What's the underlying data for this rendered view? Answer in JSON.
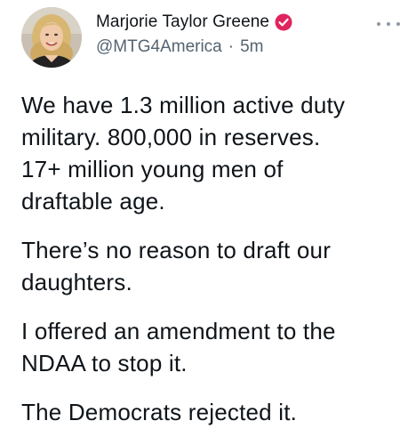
{
  "tweet": {
    "author": {
      "display_name": "Marjorie Taylor Greene",
      "handle": "@MTG4America",
      "verified_badge": "red-verified-badge-icon",
      "badge_color": "#e0245e"
    },
    "separator": "·",
    "time_ago": "5m",
    "more_icon": "ellipsis-icon",
    "paragraphs": [
      "We have 1.3 million active duty\nmilitary. 800,000 in reserves.\n17+ million young men of\ndraftable age.",
      "There’s no reason to draft our\ndaughters.",
      "I offered an amendment to the\nNDAA to stop it.",
      "The Democrats rejected it."
    ]
  }
}
